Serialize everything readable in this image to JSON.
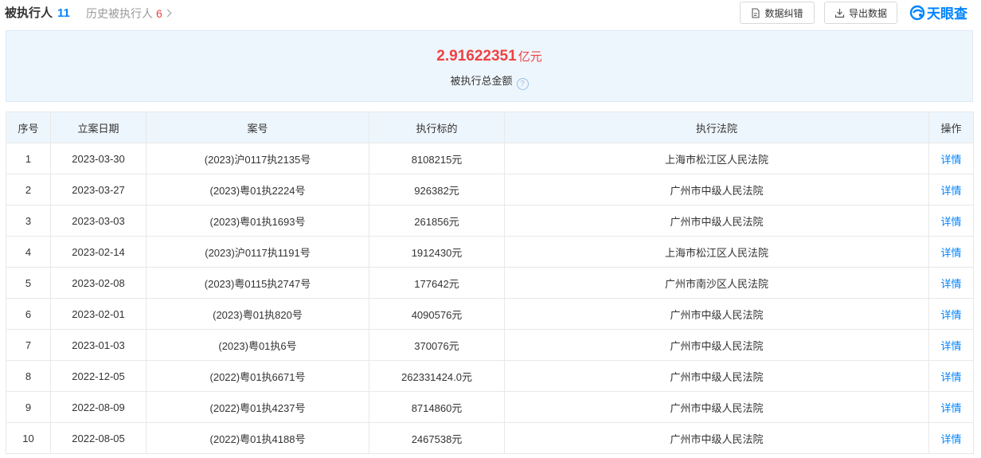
{
  "header": {
    "tab_main_label": "被执行人",
    "tab_main_count": "11",
    "tab_history_label": "历史被执行人",
    "tab_history_count": "6",
    "btn_correct": "数据纠错",
    "btn_export": "导出数据",
    "logo_text": "天眼查"
  },
  "summary": {
    "amount": "2.91622351",
    "unit": "亿元",
    "label": "被执行总金额",
    "help": "?"
  },
  "table": {
    "columns": [
      "序号",
      "立案日期",
      "案号",
      "执行标的",
      "执行法院",
      "操作"
    ],
    "rows": [
      [
        "1",
        "2023-03-30",
        "(2023)沪0117执2135号",
        "8108215元",
        "上海市松江区人民法院",
        "详情"
      ],
      [
        "2",
        "2023-03-27",
        "(2023)粤01执2224号",
        "926382元",
        "广州市中级人民法院",
        "详情"
      ],
      [
        "3",
        "2023-03-03",
        "(2023)粤01执1693号",
        "261856元",
        "广州市中级人民法院",
        "详情"
      ],
      [
        "4",
        "2023-02-14",
        "(2023)沪0117执1191号",
        "1912430元",
        "上海市松江区人民法院",
        "详情"
      ],
      [
        "5",
        "2023-02-08",
        "(2023)粤0115执2747号",
        "177642元",
        "广州市南沙区人民法院",
        "详情"
      ],
      [
        "6",
        "2023-02-01",
        "(2023)粤01执820号",
        "4090576元",
        "广州市中级人民法院",
        "详情"
      ],
      [
        "7",
        "2023-01-03",
        "(2023)粤01执6号",
        "370076元",
        "广州市中级人民法院",
        "详情"
      ],
      [
        "8",
        "2022-12-05",
        "(2022)粤01执6671号",
        "262331424.0元",
        "广州市中级人民法院",
        "详情"
      ],
      [
        "9",
        "2022-08-09",
        "(2022)粤01执4237号",
        "8714860元",
        "广州市中级人民法院",
        "详情"
      ],
      [
        "10",
        "2022-08-05",
        "(2022)粤01执4188号",
        "2467538元",
        "广州市中级人民法院",
        "详情"
      ]
    ]
  },
  "colors": {
    "accent": "#0084ff",
    "amount": "#f04142",
    "header_bg": "#eef6fd"
  },
  "icons": {
    "correct": "document-edit-icon",
    "export": "download-icon",
    "logo": "tianyancha-logo-icon",
    "history_chevron": "chevron-right-icon",
    "help": "question-circle-icon"
  }
}
